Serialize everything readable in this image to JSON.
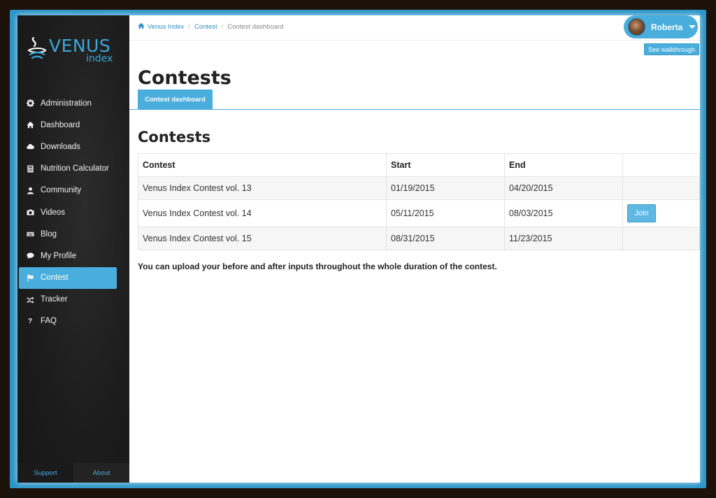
{
  "brand": {
    "name": "VENUS",
    "sub": "index"
  },
  "sidebar": {
    "items": [
      {
        "label": "Administration",
        "icon": "gear-icon"
      },
      {
        "label": "Dashboard",
        "icon": "home-icon"
      },
      {
        "label": "Downloads",
        "icon": "cloud-icon"
      },
      {
        "label": "Nutrition Calculator",
        "icon": "calculator-icon"
      },
      {
        "label": "Community",
        "icon": "user-icon"
      },
      {
        "label": "Videos",
        "icon": "camera-icon"
      },
      {
        "label": "Blog",
        "icon": "keyboard-icon"
      },
      {
        "label": "My Profile",
        "icon": "comment-icon"
      },
      {
        "label": "Contest",
        "icon": "flag-icon",
        "active": true
      },
      {
        "label": "Tracker",
        "icon": "shuffle-icon"
      },
      {
        "label": "FAQ",
        "icon": "question-icon"
      }
    ],
    "footer": {
      "support": "Support",
      "about": "About"
    }
  },
  "breadcrumb": {
    "items": [
      "Venus Index",
      "Contest",
      "Contest dashboard"
    ],
    "separator": "/"
  },
  "user": {
    "name": "Roberta"
  },
  "walkthrough_label": "See walkthrough",
  "page_title": "Contests",
  "tabs": [
    {
      "label": "Contest dashboard",
      "active": true
    }
  ],
  "section_title": "Contests",
  "table": {
    "headers": [
      "Contest",
      "Start",
      "End",
      ""
    ],
    "rows": [
      {
        "contest": "Venus Index Contest vol. 13",
        "start": "01/19/2015",
        "end": "04/20/2015",
        "action": ""
      },
      {
        "contest": "Venus Index Contest vol. 14",
        "start": "05/11/2015",
        "end": "08/03/2015",
        "action": "Join"
      },
      {
        "contest": "Venus Index Contest vol. 15",
        "start": "08/31/2015",
        "end": "11/23/2015",
        "action": ""
      }
    ]
  },
  "note": "You can upload your before and after inputs throughout the whole duration of the contest.",
  "colors": {
    "accent": "#4aaedd",
    "frame": "#2b95c8",
    "sidebar_bg": "#1d1d1d",
    "link": "#2c91c9"
  }
}
